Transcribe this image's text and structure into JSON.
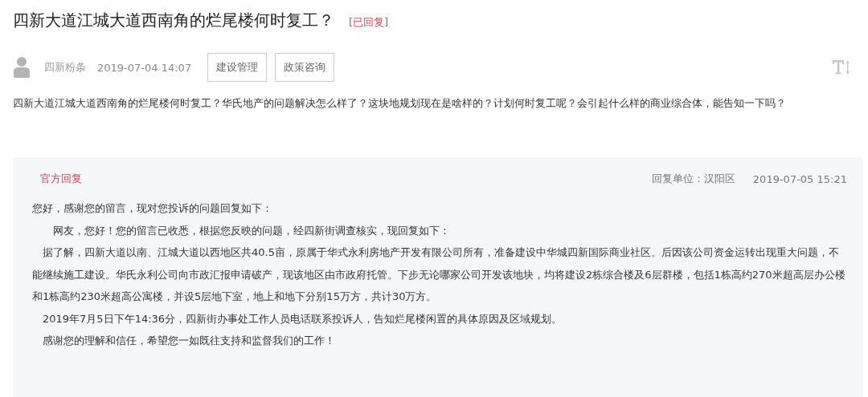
{
  "question": {
    "title": "四新大道江城大道西南角的烂尾楼何时复工？",
    "status": "[已回复]",
    "replied": true,
    "author": "四新粉条",
    "time": "2019-07-04 14:07",
    "tags": [
      "建设管理",
      "政策咨询"
    ],
    "body": "四新大道江城大道西南角的烂尾楼何时复工？华氏地产的问题解决怎么样了？这块地规划现在是啥样的？计划何时复工呢？会引起什么样的商业综合体，能告知一下吗？"
  },
  "reply": {
    "label": "官方回复",
    "unit": "回复单位：汉阳区",
    "time": "2019-07-05 15:21",
    "paragraphs": [
      "您好，感谢您的留言，现对您投诉的问题回复如下：",
      "　　网友，您好！您的留言已收悉，根据您反映的问题，经四新街调查核实，现回复如下：",
      "　据了解，四新大道以南、江城大道以西地区共40.5亩，原属于华式永利房地产开发有限公司所有，准备建设中华城四新国际商业社区。后因该公司资金运转出现重大问题，不能继续施工建设。华氏永利公司向市政汇报申请破产，现该地区由市政府托管。下步无论哪家公司开发该地块，均将建设2栋综合楼及6层群楼，包括1栋高约270米超高层办公楼和1栋高约230米超高公寓楼，并设5层地下室，地上和地下分别15万方，共计30万方。",
      "　2019年7月5日下午14:36分，四新街办事处工作人员电话联系投诉人，告知烂尾楼闲置的具体原因及区域规划。",
      "　感谢您的理解和信任，希望您一如既往支持和监督我们的工作！"
    ]
  }
}
